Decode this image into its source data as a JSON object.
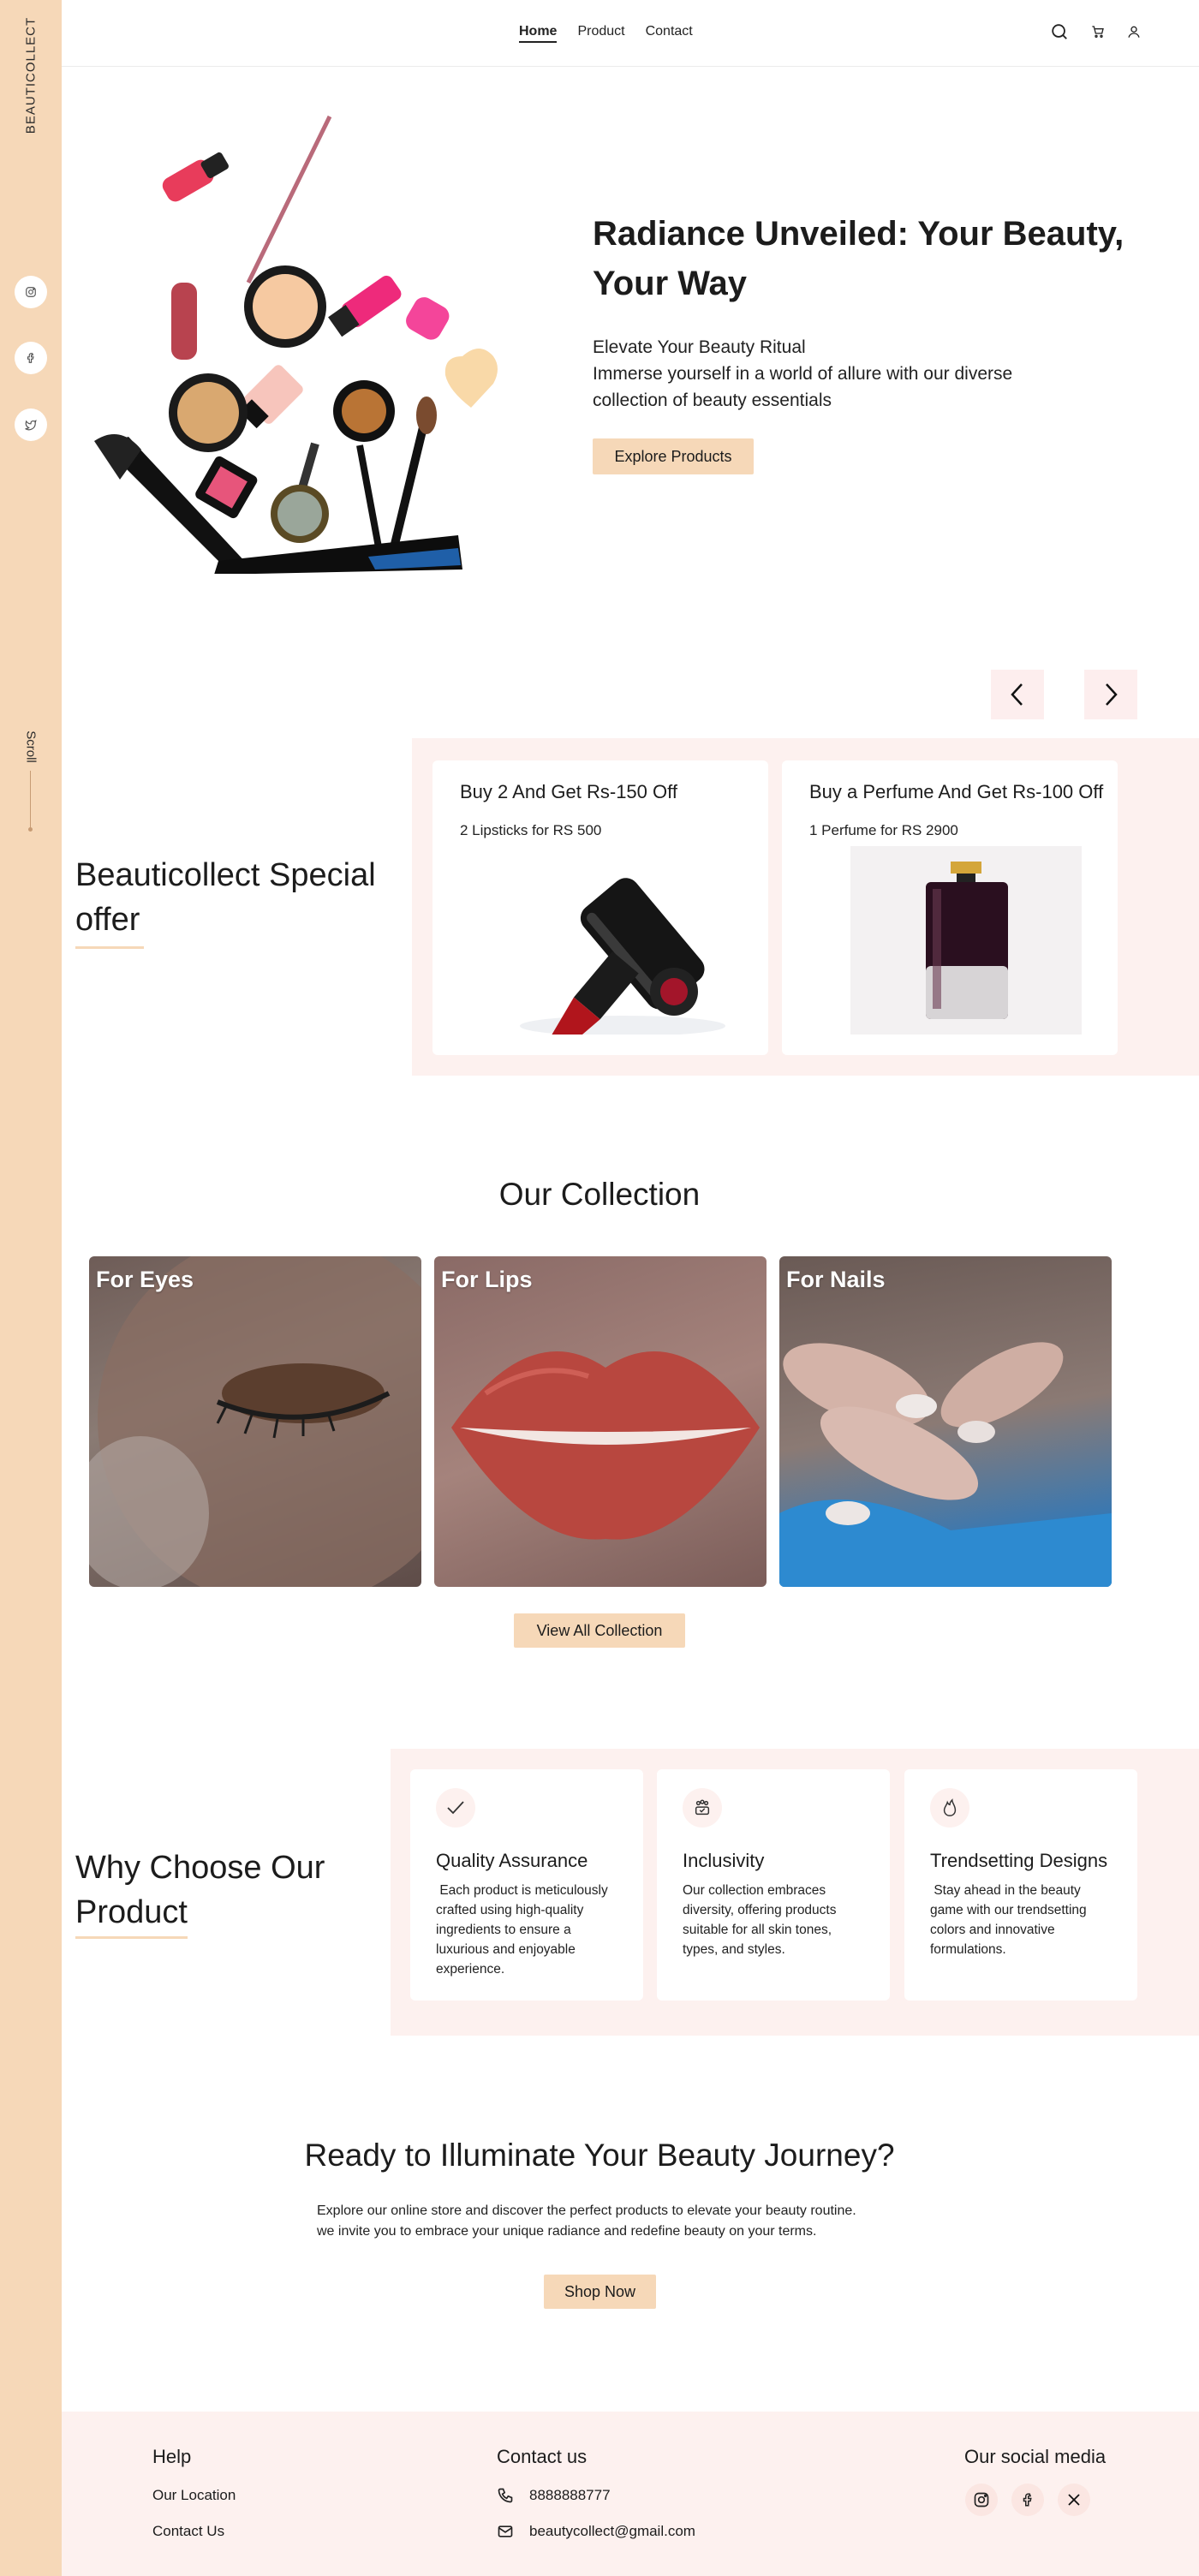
{
  "brand": "BEAUTICOLLECT",
  "sidebar": {
    "scroll_label": "Scroll",
    "social_icons": [
      "instagram-icon",
      "facebook-icon",
      "twitter-icon"
    ]
  },
  "nav": {
    "items": [
      "Home",
      "Product",
      "Contact"
    ],
    "active": "Home"
  },
  "header_icons": [
    "search-icon",
    "cart-icon",
    "user-icon"
  ],
  "hero": {
    "title": "Radiance Unveiled: Your Beauty, Your Way",
    "subtitle": "Elevate Your Beauty Ritual",
    "description": "Immerse yourself in a world of allure with our diverse collection of beauty essentials",
    "cta": "Explore Products"
  },
  "offers": {
    "title": "Beauticollect Special offer",
    "cards": [
      {
        "title": "Buy 2 And Get Rs-150 Off",
        "subtitle": "2 Lipsticks for RS 500"
      },
      {
        "title": "Buy a Perfume And Get Rs-100 Off",
        "subtitle": "1 Perfume for RS 2900"
      }
    ]
  },
  "collection": {
    "title": "Our Collection",
    "cards": [
      {
        "label": "For Eyes"
      },
      {
        "label": "For Lips"
      },
      {
        "label": "For Nails"
      }
    ],
    "cta": "View All Collection"
  },
  "why": {
    "title": "Why Choose Our Product",
    "cards": [
      {
        "title": "Quality Assurance",
        "description": " Each product is meticulously crafted using high-quality ingredients to ensure a luxurious and enjoyable experience.",
        "icon": "check-icon"
      },
      {
        "title": "Inclusivity",
        "description": "Our collection embraces diversity, offering products suitable for all skin tones, types, and styles.",
        "icon": "people-icon"
      },
      {
        "title": "Trendsetting Designs",
        "description": " Stay ahead in the beauty game with our trendsetting colors and innovative formulations.",
        "icon": "flame-icon"
      }
    ]
  },
  "cta_section": {
    "title": "Ready to Illuminate Your Beauty Journey?",
    "line1": "Explore our online store and discover the perfect products to elevate your beauty routine.",
    "line2": "we invite you to embrace your unique radiance and redefine beauty on your terms.",
    "button": "Shop Now"
  },
  "footer": {
    "help": {
      "title": "Help",
      "links": [
        "Our Location",
        "Contact Us"
      ]
    },
    "contact": {
      "title": "Contact us",
      "phone": "8888888777",
      "email": "beautycollect@gmail.com"
    },
    "social": {
      "title": "Our social media",
      "icons": [
        "instagram-icon",
        "facebook-icon",
        "x-icon"
      ]
    }
  },
  "colors": {
    "accent": "#f6d8b8",
    "soft_pink": "#fdf1ef",
    "text": "#1c1c1c"
  }
}
